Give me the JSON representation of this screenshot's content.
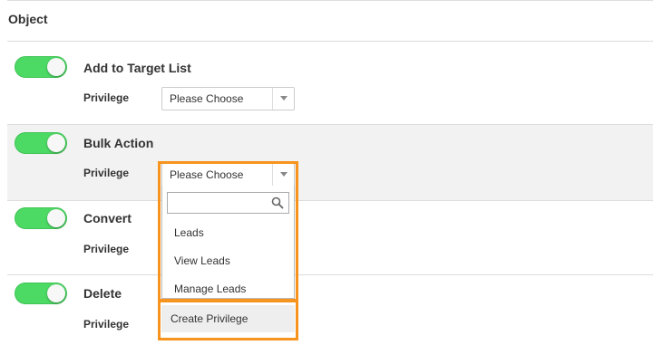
{
  "header": {
    "title": "Object"
  },
  "rows": [
    {
      "title": "Add to Target List",
      "privilege_label": "Privilege",
      "select_value": "Please Choose",
      "toggle_on": true
    },
    {
      "title": "Bulk Action",
      "privilege_label": "Privilege",
      "select_value": "Please Choose",
      "toggle_on": true
    },
    {
      "title": "Convert",
      "privilege_label": "Privilege",
      "toggle_on": true
    },
    {
      "title": "Delete",
      "privilege_label": "Privilege",
      "toggle_on": true
    }
  ],
  "dropdown": {
    "search_value": "",
    "options": [
      "Leads",
      "View Leads",
      "Manage Leads"
    ],
    "create_label": "Create Privilege"
  },
  "colors": {
    "toggle_on": "#4cd964",
    "highlight_border": "#f7941d",
    "row_highlight": "#f2f2f2"
  }
}
